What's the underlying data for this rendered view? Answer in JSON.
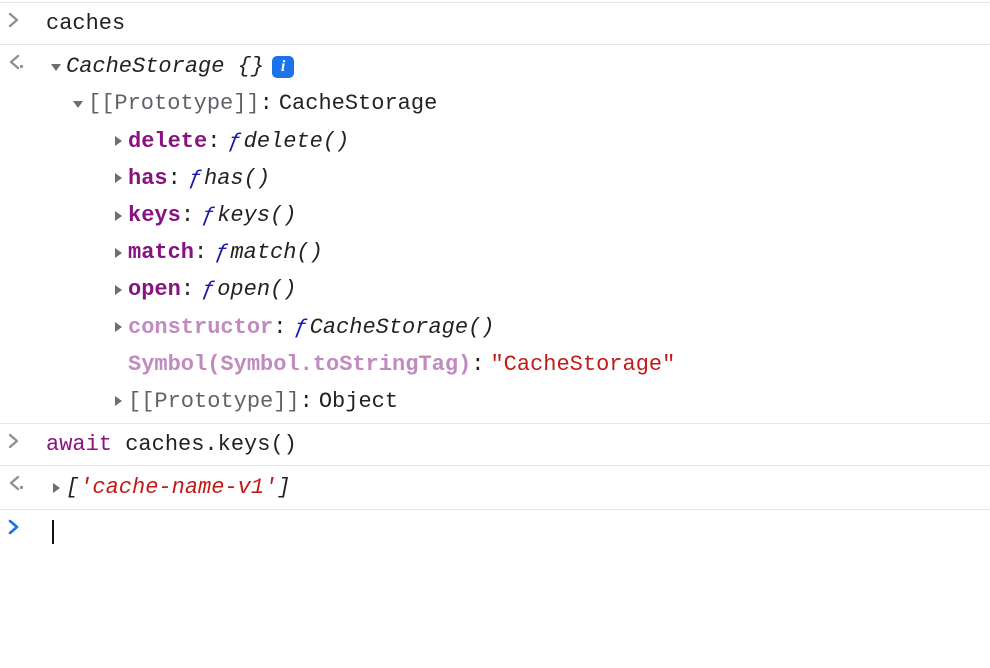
{
  "entries": {
    "input1": "caches",
    "output1": {
      "className": "CacheStorage",
      "braces": "{}",
      "info": "i",
      "protoLabel": "[[Prototype]]",
      "protoValue": "CacheStorage",
      "methods": [
        {
          "name": "delete",
          "sig": "delete()"
        },
        {
          "name": "has",
          "sig": "has()"
        },
        {
          "name": "keys",
          "sig": "keys()"
        },
        {
          "name": "match",
          "sig": "match()"
        },
        {
          "name": "open",
          "sig": "open()"
        }
      ],
      "constructor": {
        "name": "constructor",
        "sig": "CacheStorage()"
      },
      "symbolTag": {
        "key": "Symbol(Symbol.toStringTag)",
        "value": "\"CacheStorage\""
      },
      "innerProto": {
        "label": "[[Prototype]]",
        "value": "Object"
      }
    },
    "input2": {
      "await": "await",
      "rest": " caches.keys()"
    },
    "output2": {
      "open": "[",
      "val": "'cache-name-v1'",
      "close": "]"
    }
  }
}
